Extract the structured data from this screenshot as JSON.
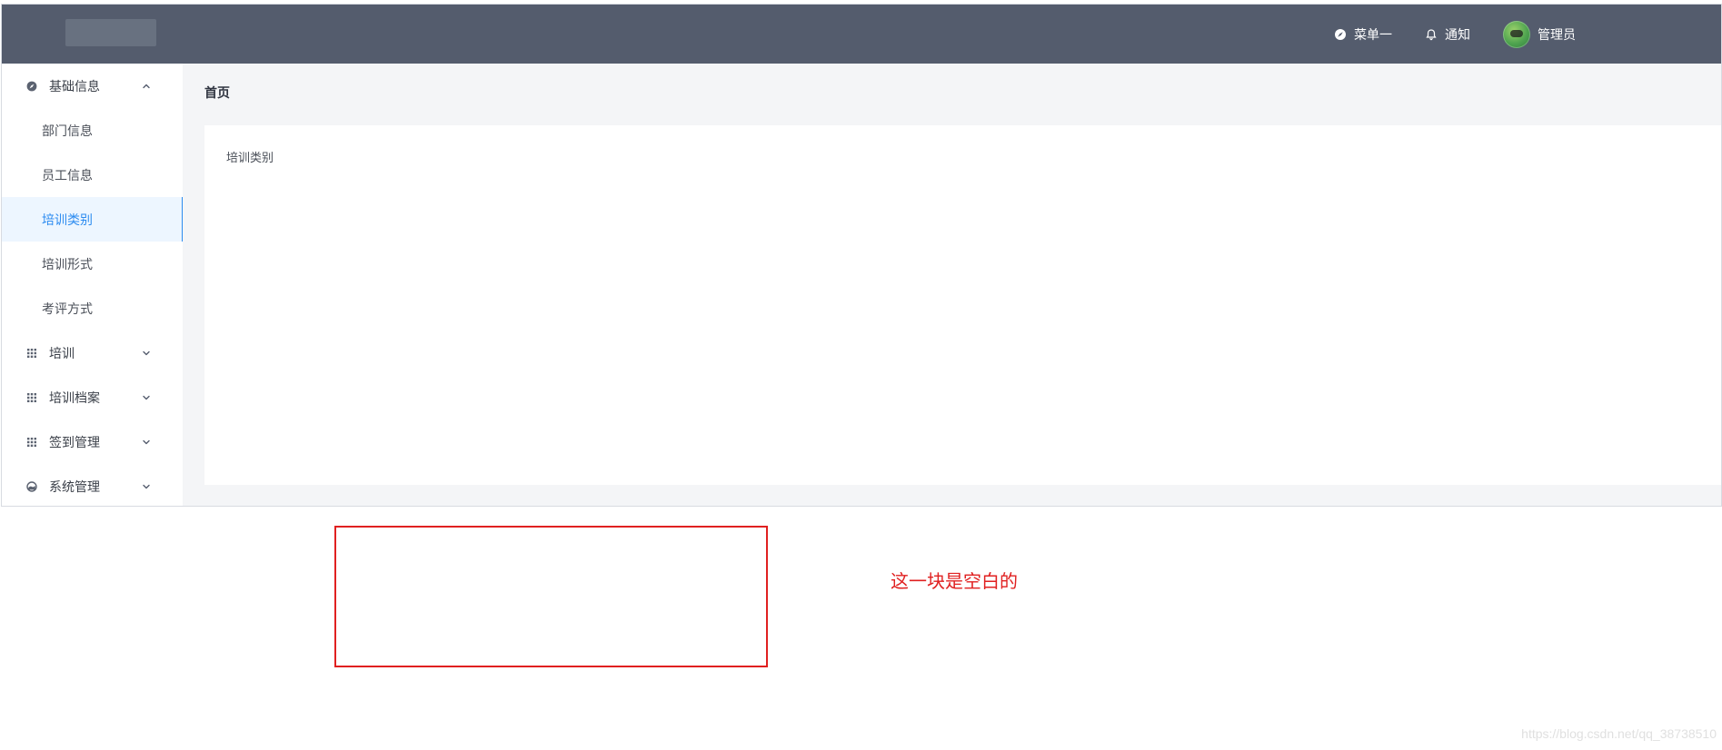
{
  "header": {
    "nav": {
      "menu_label": "菜单一",
      "notify_label": "通知",
      "user_label": "管理员"
    }
  },
  "sidebar": {
    "groups": [
      {
        "label": "基础信息",
        "icon": "compass-icon",
        "expanded": true,
        "items": [
          {
            "label": "部门信息"
          },
          {
            "label": "员工信息"
          },
          {
            "label": "培训类别",
            "active": true
          },
          {
            "label": "培训形式"
          },
          {
            "label": "考评方式"
          }
        ]
      },
      {
        "label": "培训",
        "icon": "grid-icon",
        "expanded": false
      },
      {
        "label": "培训档案",
        "icon": "grid-icon",
        "expanded": false
      },
      {
        "label": "签到管理",
        "icon": "grid-icon",
        "expanded": false
      },
      {
        "label": "系统管理",
        "icon": "settings-icon",
        "expanded": false
      }
    ]
  },
  "main": {
    "breadcrumb": "首页",
    "content_text": "培训类别"
  },
  "annotation": {
    "text": "这一块是空白的"
  },
  "watermark": "https://blog.csdn.net/qq_38738510",
  "colors": {
    "header_bg": "#545c6d",
    "active_blue": "#2d8cf0",
    "annotation_red": "#e02020"
  }
}
